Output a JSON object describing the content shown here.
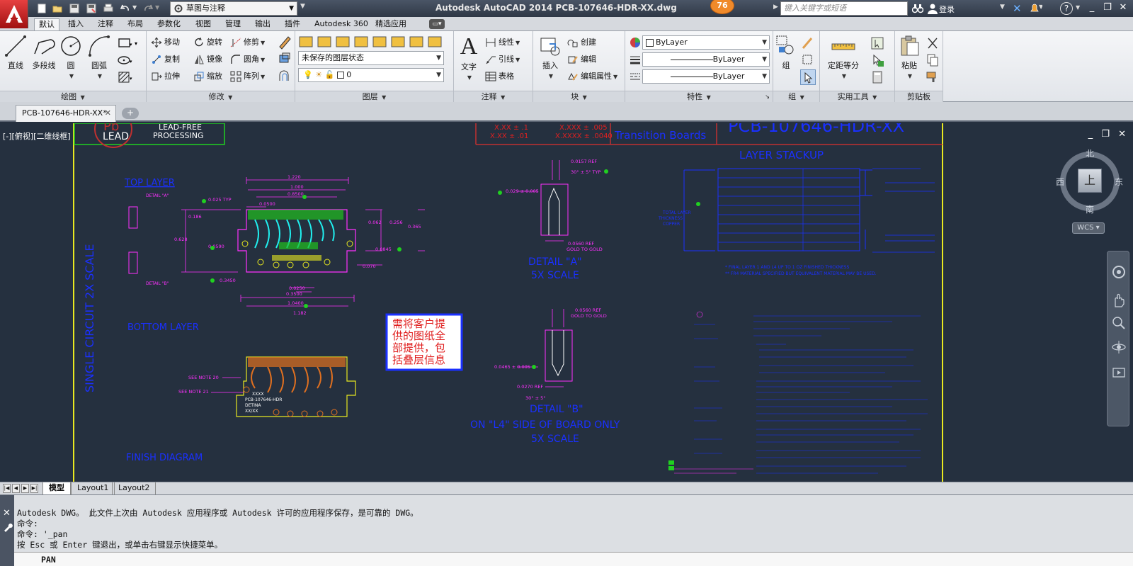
{
  "window": {
    "title": "Autodesk AutoCAD 2014    PCB-107646-HDR-XX.dwg",
    "workspace": "草图与注释",
    "badge_count": "76",
    "search_placeholder": "键入关键字或短语",
    "login": "登录"
  },
  "ribbon": {
    "tabs": [
      "默认",
      "插入",
      "注释",
      "布局",
      "参数化",
      "视图",
      "管理",
      "输出",
      "插件",
      "Autodesk 360",
      "精选应用"
    ],
    "panels": {
      "draw": {
        "title": "绘图",
        "line": "直线",
        "polyline": "多段线",
        "circle": "圆",
        "arc": "圆弧"
      },
      "modify": {
        "title": "修改",
        "move": "移动",
        "rotate": "旋转",
        "trim": "修剪",
        "copy": "复制",
        "mirror": "镜像",
        "fillet": "圆角",
        "stretch": "拉伸",
        "scale": "缩放",
        "array": "阵列"
      },
      "layers": {
        "title": "图层",
        "layer_state": "未保存的图层状态",
        "current_layer": "0"
      },
      "annotation": {
        "title": "注释",
        "text": "文字",
        "linear": "线性",
        "leader": "引线",
        "table": "表格"
      },
      "block": {
        "title": "块",
        "insert": "插入",
        "create": "创建",
        "edit": "编辑",
        "edit_attr": "编辑属性"
      },
      "properties": {
        "title": "特性",
        "color": "ByLayer",
        "linetype": "ByLayer",
        "lineweight": "ByLayer"
      },
      "groups": {
        "title": "组",
        "group": "组"
      },
      "utilities": {
        "title": "实用工具",
        "measure": "定距等分"
      },
      "clipboard": {
        "title": "剪贴板",
        "paste": "粘贴"
      }
    }
  },
  "document": {
    "tab_name": "PCB-107646-HDR-XX*",
    "viewport_label": "[-][俯视][二维线框]"
  },
  "viewcube": {
    "north": "北",
    "south": "南",
    "east": "东",
    "west": "西",
    "face": "上",
    "wcs": "WCS"
  },
  "drawing": {
    "lead_free": "LEAD-FREE",
    "processing": "PROCESSING",
    "lead": "LEAD",
    "pb": "Pb",
    "tol1": "X.XX ± .1",
    "tol2": "X.XX ± .01",
    "tol3": "X.XXX ± .005",
    "tol4": "X.XXXX ± .0040",
    "transition": "Transition Boards",
    "part_number": "PCB-107646-HDR-XX",
    "layer_stackup": "LAYER STACKUP",
    "top_layer": "TOP LAYER",
    "bottom_layer": "BOTTOM LAYER",
    "finish_diagram": "FINISH DIAGRAM",
    "single_circuit": "SINGLE CIRCUIT 2X SCALE",
    "detail_a": "DETAIL \"A\"",
    "detail_a_scale": "5X SCALE",
    "detail_b": "DETAIL \"B\"",
    "detail_b_side": "ON \"L4\" SIDE OF BOARD ONLY",
    "detail_b_scale": "5X SCALE",
    "note_box": [
      "需将客户提",
      "供的图纸全",
      "部提供，包",
      "括叠层信息"
    ],
    "see_note_20": "SEE NOTE 20",
    "see_note_21": "SEE NOTE 21",
    "detail_a_label": "DETAIL \"A\"",
    "detail_b_label": "DETAIL \"B\"",
    "dims": [
      "1.220",
      "1.000",
      "0.8500",
      "0.0500",
      "0.025 TYP",
      "0.186",
      "0.628",
      "0.0590",
      "0.3450",
      "0.0250",
      "0.3500",
      "1.0400",
      "1.182",
      "0.062",
      "0.256",
      "0.365",
      "0.070",
      "0.0845",
      "0.0157 REF",
      "30° ± 5° TYP",
      "0.029 ± 0.005",
      "0.0560 REF",
      "GOLD TO GOLD",
      "0.0560 REF",
      "GOLD TO GOLD",
      "0.0465 ± 0.005",
      "0.0270 REF",
      "30° ± 5°"
    ]
  },
  "layout_tabs": [
    "模型",
    "Layout1",
    "Layout2"
  ],
  "command": {
    "history": [
      "Autodesk DWG。  此文件上次由 Autodesk 应用程序或 Autodesk 许可的应用程序保存，是可靠的 DWG。",
      "命令:",
      "命令: '_pan",
      "按 Esc 或 Enter 键退出，或单击右键显示快捷菜单。"
    ],
    "current": "PAN"
  }
}
